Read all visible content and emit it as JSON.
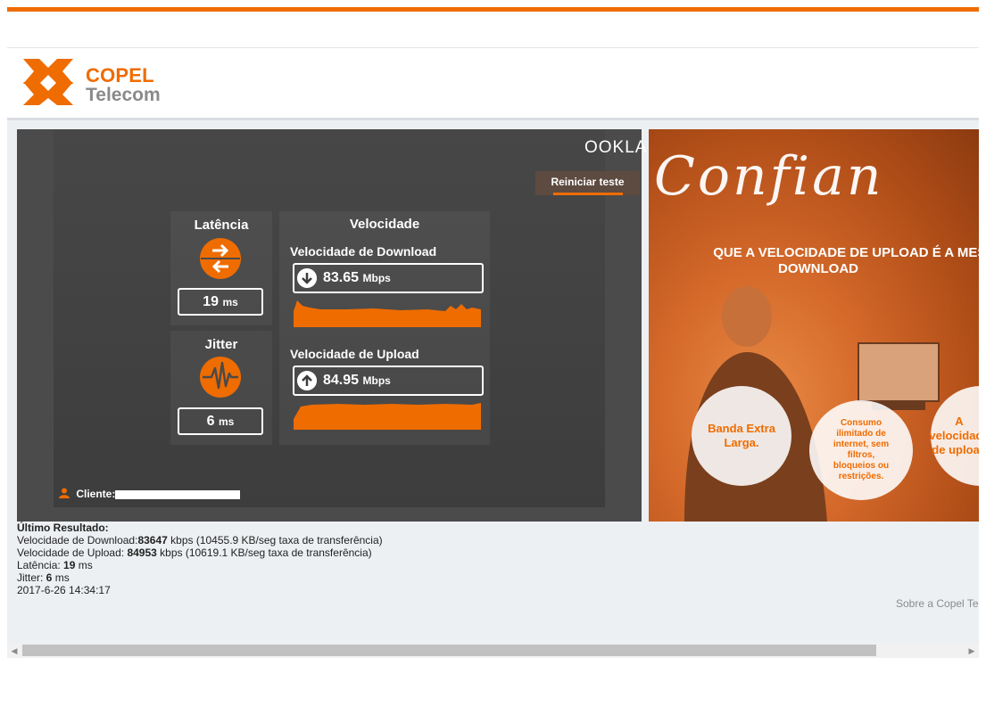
{
  "header": {
    "logo": {
      "line1": "COPEL",
      "line2": "Telecom"
    },
    "colors": {
      "accent": "#ef6c00",
      "gray": "#8a8a8a"
    }
  },
  "speedtest": {
    "brand": "OOKLA",
    "restart_label": "Reiniciar teste",
    "latency": {
      "title": "Latência",
      "value": "19",
      "unit": "ms"
    },
    "jitter": {
      "title": "Jitter",
      "value": "6",
      "unit": "ms"
    },
    "speed": {
      "title": "Velocidade",
      "download": {
        "label": "Velocidade de Download",
        "value": "83.65",
        "unit": "Mbps"
      },
      "upload": {
        "label": "Velocidade de Upload",
        "value": "84.95",
        "unit": "Mbps"
      }
    },
    "client_label": "Cliente:"
  },
  "ad": {
    "script_text": "Confian",
    "headline_1": "QUE A VELOCIDADE DE UPLOAD É A MESMA DO",
    "headline_2": "DOWNLOAD",
    "circle_1": "Banda Extra Larga.",
    "circle_2": "Consumo ilimitado de internet, sem filtros, bloqueios ou restrições.",
    "circle_3": "A velocidade de upload"
  },
  "results": {
    "title": "Último Resultado:",
    "download_label": "Velocidade de Download:",
    "download_value": "83647",
    "download_rest": " kbps (10455.9 KB/seg taxa de transferência)",
    "upload_label": "Velocidade de Upload: ",
    "upload_value": "84953",
    "upload_rest": " kbps (10619.1 KB/seg taxa de transferência)",
    "latency_label": "Latência: ",
    "latency_value": "19",
    "latency_rest": " ms",
    "jitter_label": "Jitter: ",
    "jitter_value": "6",
    "jitter_rest": " ms",
    "timestamp": "2017-6-26 14:34:17"
  },
  "footer": {
    "about_link": "Sobre a Copel Telecom"
  }
}
